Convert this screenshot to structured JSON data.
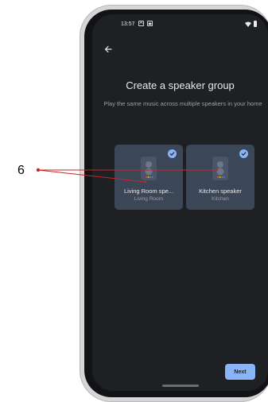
{
  "status_bar": {
    "time": "13:57"
  },
  "header": {
    "back_icon": "arrow-left-icon"
  },
  "main": {
    "title": "Create a speaker group",
    "subtitle": "Play the same music across multiple speakers in your home",
    "speakers": [
      {
        "name": "Living Room spe...",
        "room": "Living Room",
        "selected": true
      },
      {
        "name": "Kitchen speaker",
        "room": "Kitchen",
        "selected": true
      }
    ]
  },
  "footer": {
    "next_label": "Next"
  },
  "callout": {
    "number": "6"
  },
  "colors": {
    "accent": "#8ab4f8",
    "card": "#3b4656",
    "background": "#1f2023"
  }
}
